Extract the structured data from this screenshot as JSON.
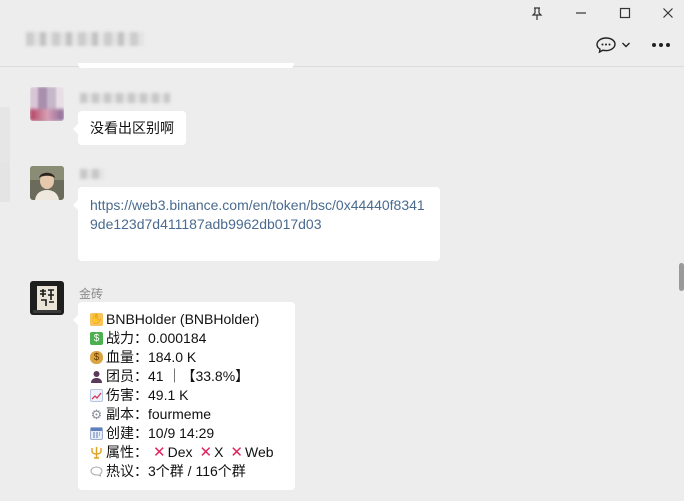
{
  "window": {
    "pin_icon": "pin-icon",
    "minimize_icon": "minimize-icon",
    "maximize_icon": "maximize-icon",
    "close_icon": "close-icon"
  },
  "header": {
    "chat_icon": "chat-bubble-icon",
    "more_icon": "more-icon"
  },
  "messages": [
    {
      "text": "没看出区别啊"
    },
    {
      "link": "https://web3.binance.com/en/token/bsc/0x44440f83419de123d7d411187adb9962db017d03"
    },
    {
      "sender": "金砖",
      "lines": [
        {
          "icon": "hand-icon",
          "label": "BNBHolder (BNBHolder)"
        },
        {
          "icon": "money-icon",
          "label": "战力：",
          "value": "0.000184"
        },
        {
          "icon": "money-bag-icon",
          "label": "血量：",
          "value": "184.0 K"
        },
        {
          "icon": "person-icon",
          "label": "团员：",
          "value": "41 ｜【33.8%】"
        },
        {
          "icon": "chart-icon",
          "label": "伤害：",
          "value": "49.1 K"
        },
        {
          "icon": "gear-icon",
          "label": "副本：",
          "value": "fourmeme"
        },
        {
          "icon": "calendar-icon",
          "label": "创建：",
          "value": "10/9 14:29"
        },
        {
          "icon": "trident-icon",
          "label": "属性：",
          "attrs": [
            "Dex",
            "X",
            "Web"
          ]
        },
        {
          "icon": "speech-icon",
          "label": "热议：",
          "value": "3个群 / 116个群"
        }
      ]
    }
  ]
}
